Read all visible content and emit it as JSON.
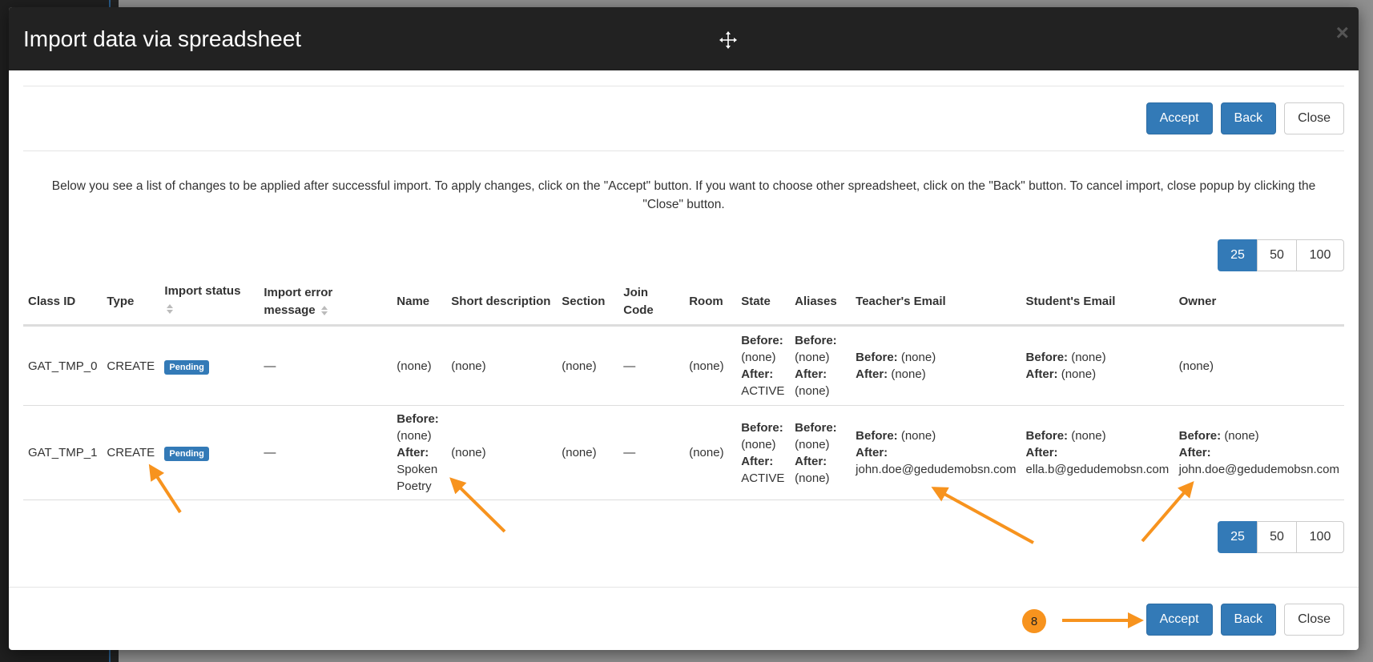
{
  "modal": {
    "title": "Import data via spreadsheet",
    "close_symbol": "×"
  },
  "buttons": {
    "accept": "Accept",
    "back": "Back",
    "close": "Close"
  },
  "info_text": "Below you see a list of changes to be applied after successful import. To apply changes, click on the \"Accept\" button. If you want to choose other spreadsheet, click on the \"Back\" button. To cancel import, close popup by clicking the \"Close\" button.",
  "pagination": [
    "25",
    "50",
    "100"
  ],
  "pagination_active": "25",
  "table": {
    "headers": {
      "class_id": "Class ID",
      "type": "Type",
      "import_status": "Import status",
      "import_error": "Import error message",
      "name": "Name",
      "short_desc": "Short description",
      "section": "Section",
      "join_code": "Join Code",
      "room": "Room",
      "state": "State",
      "aliases": "Aliases",
      "teacher_email": "Teacher's Email",
      "student_email": "Student's Email",
      "owner": "Owner"
    },
    "labels": {
      "before": "Before:",
      "after": "After:"
    },
    "rows": [
      {
        "class_id": "GAT_TMP_0",
        "type": "CREATE",
        "status": "Pending",
        "error": "—",
        "name": "(none)",
        "short_desc": "(none)",
        "section": "(none)",
        "join_code": "—",
        "room": "(none)",
        "state_before": "(none)",
        "state_after": "ACTIVE",
        "aliases_before": "(none)",
        "aliases_after": "(none)",
        "teacher_before": "(none)",
        "teacher_after": "(none)",
        "student_before": "(none)",
        "student_after": "(none)",
        "owner": "(none)"
      },
      {
        "class_id": "GAT_TMP_1",
        "type": "CREATE",
        "status": "Pending",
        "error": "—",
        "name_before": "(none)",
        "name_after": "Spoken Poetry",
        "short_desc": "(none)",
        "section": "(none)",
        "join_code": "—",
        "room": "(none)",
        "state_before": "(none)",
        "state_after": "ACTIVE",
        "aliases_before": "(none)",
        "aliases_after": "(none)",
        "teacher_before": "(none)",
        "teacher_after": "john.doe@gedudemobsn.com",
        "student_before": "(none)",
        "student_after": "ella.b@gedudemobsn.com",
        "owner_before": "(none)",
        "owner_after": "john.doe@gedudemobsn.com"
      }
    ]
  },
  "annotation": {
    "step_number": "8",
    "color": "#f7931e"
  },
  "icons": {
    "move": "move-icon",
    "close": "close-icon"
  }
}
